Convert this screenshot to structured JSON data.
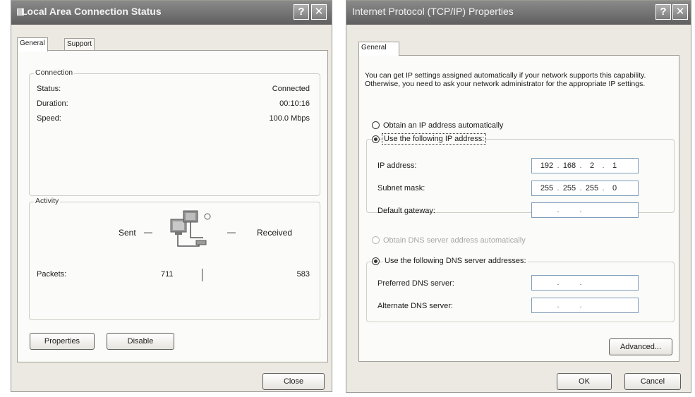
{
  "left_window": {
    "title": "Local Area Connection Status",
    "help_glyph": "?",
    "close_glyph": "✕",
    "tabs": [
      "General",
      "Support"
    ],
    "connection": {
      "group_label": "Connection",
      "rows": [
        {
          "label": "Status:",
          "value": "Connected"
        },
        {
          "label": "Duration:",
          "value": "00:10:16"
        },
        {
          "label": "Speed:",
          "value": "100.0 Mbps"
        }
      ]
    },
    "activity": {
      "group_label": "Activity",
      "sent_label": "Sent",
      "received_label": "Received",
      "dash": "—",
      "packets_label": "Packets:",
      "packets_sent": "711",
      "packets_received": "583",
      "icon": "network-computers-icon"
    },
    "buttons": {
      "properties": "Properties",
      "disable": "Disable",
      "close": "Close"
    }
  },
  "right_window": {
    "title": "Internet Protocol (TCP/IP) Properties",
    "help_glyph": "?",
    "close_glyph": "✕",
    "tabs": [
      "General"
    ],
    "description": "You can get IP settings assigned automatically if your network supports this capability. Otherwise, you need to ask your network administrator for the appropriate IP settings.",
    "ip_options": {
      "auto": "Obtain an IP address automatically",
      "manual": "Use the following IP address:"
    },
    "ip_fields": [
      {
        "label": "IP address:",
        "octets": [
          "192",
          "168",
          "2",
          "1"
        ]
      },
      {
        "label": "Subnet mask:",
        "octets": [
          "255",
          "255",
          "255",
          "0"
        ]
      },
      {
        "label": "Default gateway:",
        "octets": [
          "",
          "",
          "",
          ""
        ]
      }
    ],
    "dns_options": {
      "auto": "Obtain DNS server address automatically",
      "manual": "Use the following DNS server addresses:"
    },
    "dns_fields": [
      {
        "label": "Preferred DNS server:",
        "octets": [
          "",
          "",
          "",
          ""
        ]
      },
      {
        "label": "Alternate DNS server:",
        "octets": [
          "",
          "",
          "",
          ""
        ]
      }
    ],
    "buttons": {
      "advanced": "Advanced...",
      "ok": "OK",
      "cancel": "Cancel"
    }
  }
}
